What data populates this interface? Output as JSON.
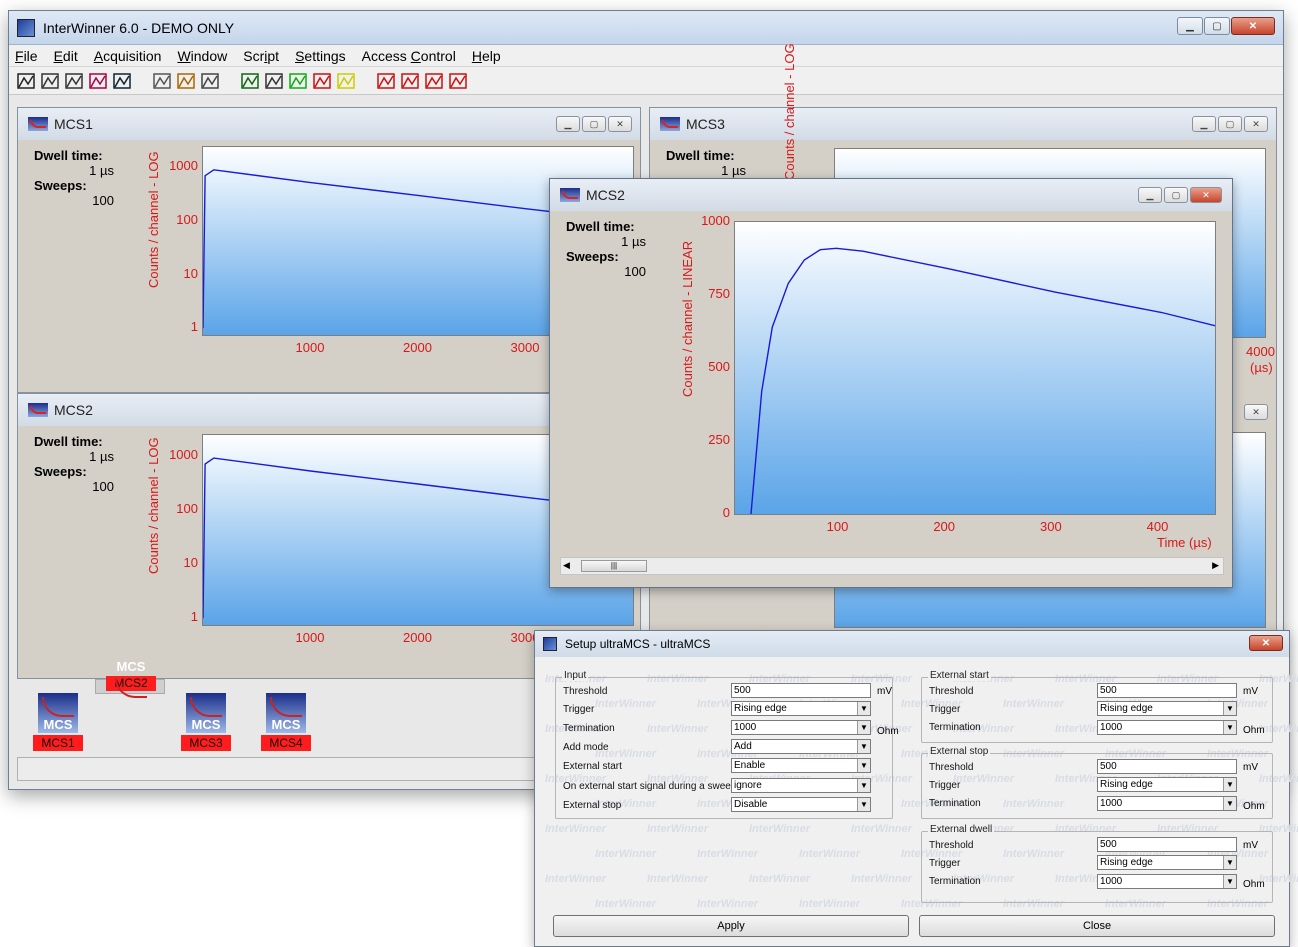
{
  "app": {
    "title": "InterWinner 6.0 - DEMO ONLY",
    "menus": [
      {
        "pre": "",
        "ul": "F",
        "post": "ile"
      },
      {
        "pre": "",
        "ul": "E",
        "post": "dit"
      },
      {
        "pre": "",
        "ul": "A",
        "post": "cquisition"
      },
      {
        "pre": "",
        "ul": "W",
        "post": "indow"
      },
      {
        "pre": "Scr",
        "ul": "i",
        "post": "pt"
      },
      {
        "pre": "",
        "ul": "S",
        "post": "ettings"
      },
      {
        "pre": "Access ",
        "ul": "C",
        "post": "ontrol"
      },
      {
        "pre": "",
        "ul": "H",
        "post": "elp"
      }
    ],
    "toolbar_icons": [
      "spectrum-icon",
      "list-icon",
      "table-icon",
      "person-chart-icon",
      "save-icon",
      "brush-icon",
      "magic-icon",
      "flag-icon",
      "grid-icon",
      "stopwatch-icon",
      "traffic-green-icon",
      "traffic-red-icon",
      "traffic-yellow-icon",
      "peak-icon",
      "peak-add-icon",
      "peak-add2-icon",
      "peak-remove-icon"
    ]
  },
  "labels": {
    "dwell_time": "Dwell time:",
    "dwell_value": "1 µs",
    "sweeps": "Sweeps:",
    "sweeps_value": "100",
    "ylabel_log": "Counts / channel - LOG",
    "ylabel_linear": "Counts / channel - LINEAR",
    "xlabel_time": "Time (µs)",
    "xlabel_partial": "(µs)"
  },
  "windows": {
    "mcs1": {
      "title": "MCS1"
    },
    "mcs2_back": {
      "title": "MCS2"
    },
    "mcs3": {
      "title": "MCS3"
    },
    "mcs2_front": {
      "title": "MCS2"
    }
  },
  "chart_data": [
    {
      "type": "line",
      "window": "MCS1",
      "yscale": "log",
      "ylabel": "Counts / channel - LOG",
      "yticks": [
        "1000",
        "100",
        "10",
        "1"
      ],
      "xticks": [
        "1000",
        "2000",
        "3000"
      ],
      "series": [
        {
          "x": [
            0,
            20,
            100,
            1000,
            2000,
            3000,
            3500
          ],
          "y": [
            1,
            700,
            900,
            520,
            300,
            170,
            130
          ]
        }
      ]
    },
    {
      "type": "line",
      "window": "MCS2",
      "yscale": "log",
      "ylabel": "Counts / channel - LOG",
      "yticks": [
        "1000",
        "100",
        "10",
        "1"
      ],
      "xticks": [
        "1000",
        "2000",
        "3000"
      ],
      "series": [
        {
          "x": [
            0,
            20,
            100,
            1000,
            2000,
            3000,
            3500
          ],
          "y": [
            1,
            700,
            900,
            520,
            300,
            170,
            130
          ]
        }
      ]
    },
    {
      "type": "line",
      "window": "MCS3",
      "yscale": "log",
      "ylabel": "Counts / channel - LOG",
      "xticks": [
        "4000"
      ],
      "xlabel": "(µs)"
    },
    {
      "type": "line",
      "window": "MCS2 (front)",
      "yscale": "linear",
      "ylabel": "Counts / channel - LINEAR",
      "xlabel": "Time (µs)",
      "yticks": [
        "1000",
        "750",
        "500",
        "250",
        "0"
      ],
      "xticks": [
        "100",
        "200",
        "300",
        "400"
      ],
      "ylim": [
        0,
        1000
      ],
      "xlim": [
        0,
        450
      ],
      "series": [
        {
          "x": [
            15,
            25,
            35,
            50,
            65,
            80,
            95,
            120,
            200,
            300,
            400,
            450
          ],
          "y": [
            0,
            420,
            640,
            790,
            870,
            905,
            910,
            900,
            840,
            760,
            690,
            645
          ]
        }
      ]
    }
  ],
  "taskbar": [
    {
      "label": "MCS1",
      "selected": false
    },
    {
      "label": "MCS2",
      "selected": true
    },
    {
      "label": "MCS3",
      "selected": false
    },
    {
      "label": "MCS4",
      "selected": false
    }
  ],
  "dialog": {
    "title": "Setup ultraMCS - ultraMCS",
    "watermark": "InterWinner",
    "input_group": "Input",
    "threshold_label": "Threshold",
    "threshold_value": "500",
    "threshold_unit": "mV",
    "trigger_label": "Trigger",
    "trigger_value": "Rising edge",
    "termination_label": "Termination",
    "termination_value": "1000",
    "termination_unit": "Ohm",
    "addmode_label": "Add mode",
    "addmode_value": "Add",
    "extstart_label": "External start",
    "extstart_value": "Enable",
    "onext_label": "On external start signal during a sweep",
    "onext_value": "ignore",
    "extstop_label": "External stop",
    "extstop_value": "Disable",
    "ext_start_group": "External start",
    "ext_stop_group": "External stop",
    "ext_dwell_group": "External dwell",
    "g_threshold": "500",
    "g_trigger": "Rising edge",
    "g_termination": "1000",
    "apply": "Apply",
    "close": "Close"
  }
}
